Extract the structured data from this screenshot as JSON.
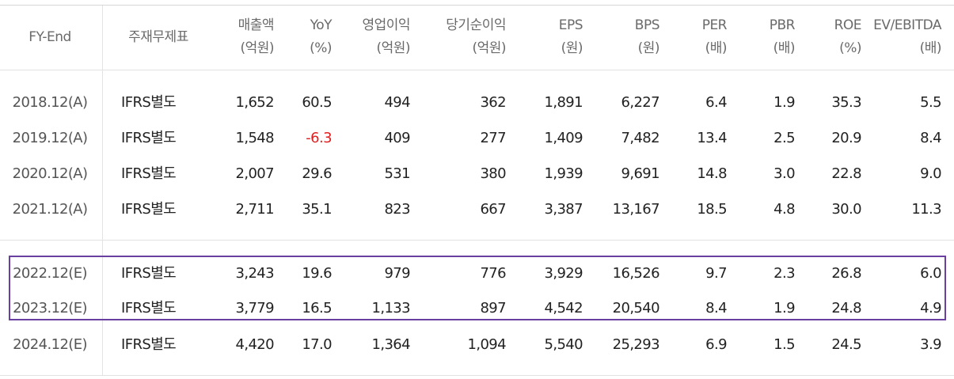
{
  "headers": [
    {
      "key": "fy",
      "line1": "FY-End",
      "line2": ""
    },
    {
      "key": "basis",
      "line1": "주재무제표",
      "line2": ""
    },
    {
      "key": "sales",
      "line1": "매출액",
      "line2": "(억원)"
    },
    {
      "key": "yoy",
      "line1": "YoY",
      "line2": "(%)"
    },
    {
      "key": "op",
      "line1": "영업이익",
      "line2": "(억원)"
    },
    {
      "key": "net",
      "line1": "당기순이익",
      "line2": "(억원)"
    },
    {
      "key": "eps",
      "line1": "EPS",
      "line2": "(원)"
    },
    {
      "key": "bps",
      "line1": "BPS",
      "line2": "(원)"
    },
    {
      "key": "per",
      "line1": "PER",
      "line2": "(배)"
    },
    {
      "key": "pbr",
      "line1": "PBR",
      "line2": "(배)"
    },
    {
      "key": "roe",
      "line1": "ROE",
      "line2": "(%)"
    },
    {
      "key": "ev",
      "line1": "EV/EBITDA",
      "line2": "(배)"
    }
  ],
  "rows": [
    {
      "fy": "2018.12(A)",
      "basis": "IFRS별도",
      "sales": "1,652",
      "yoy": "60.5",
      "op": "494",
      "net": "362",
      "eps": "1,891",
      "bps": "6,227",
      "per": "6.4",
      "pbr": "1.9",
      "roe": "35.3",
      "ev": "5.5"
    },
    {
      "fy": "2019.12(A)",
      "basis": "IFRS별도",
      "sales": "1,548",
      "yoy": "-6.3",
      "op": "409",
      "net": "277",
      "eps": "1,409",
      "bps": "7,482",
      "per": "13.4",
      "pbr": "2.5",
      "roe": "20.9",
      "ev": "8.4"
    },
    {
      "fy": "2020.12(A)",
      "basis": "IFRS별도",
      "sales": "2,007",
      "yoy": "29.6",
      "op": "531",
      "net": "380",
      "eps": "1,939",
      "bps": "9,691",
      "per": "14.8",
      "pbr": "3.0",
      "roe": "22.8",
      "ev": "9.0"
    },
    {
      "fy": "2021.12(A)",
      "basis": "IFRS별도",
      "sales": "2,711",
      "yoy": "35.1",
      "op": "823",
      "net": "667",
      "eps": "3,387",
      "bps": "13,167",
      "per": "18.5",
      "pbr": "4.8",
      "roe": "30.0",
      "ev": "11.3"
    },
    {
      "fy": "2022.12(E)",
      "basis": "IFRS별도",
      "sales": "3,243",
      "yoy": "19.6",
      "op": "979",
      "net": "776",
      "eps": "3,929",
      "bps": "16,526",
      "per": "9.7",
      "pbr": "2.3",
      "roe": "26.8",
      "ev": "6.0"
    },
    {
      "fy": "2023.12(E)",
      "basis": "IFRS별도",
      "sales": "3,779",
      "yoy": "16.5",
      "op": "1,133",
      "net": "897",
      "eps": "4,542",
      "bps": "20,540",
      "per": "8.4",
      "pbr": "1.9",
      "roe": "24.8",
      "ev": "4.9"
    },
    {
      "fy": "2024.12(E)",
      "basis": "IFRS별도",
      "sales": "4,420",
      "yoy": "17.0",
      "op": "1,364",
      "net": "1,094",
      "eps": "5,540",
      "bps": "25,293",
      "per": "6.9",
      "pbr": "1.5",
      "roe": "24.5",
      "ev": "3.9"
    }
  ],
  "colors": {
    "negative": "#e02020",
    "highlight_border": "#6b3fa0"
  }
}
